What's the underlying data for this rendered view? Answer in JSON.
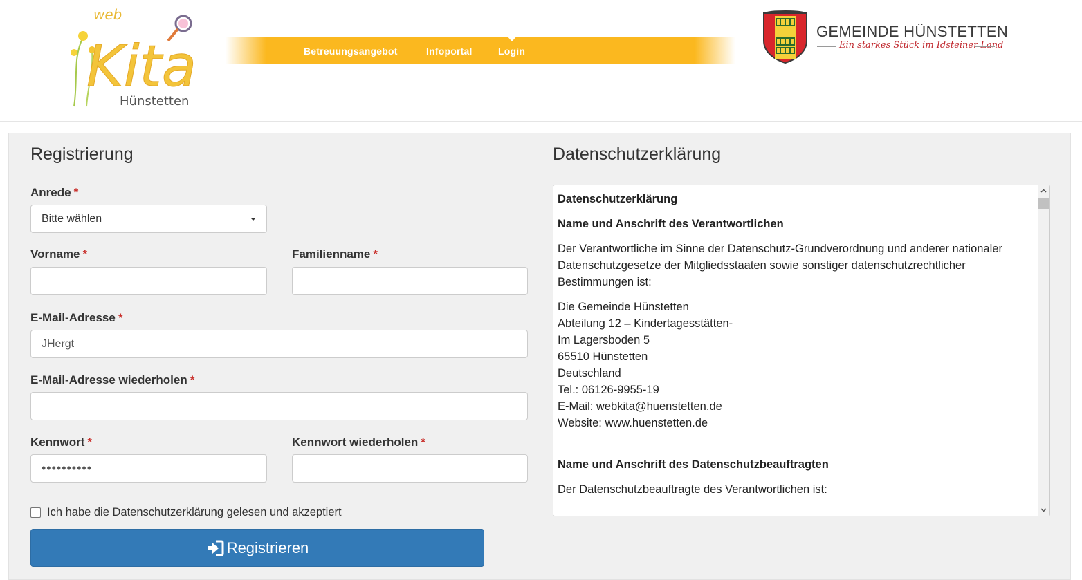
{
  "header": {
    "logo": {
      "small": "web",
      "big": "Kita",
      "sub": "Hünstetten"
    },
    "nav": [
      {
        "label": "Betreuungsangebot"
      },
      {
        "label": "Infoportal"
      },
      {
        "label": "Login"
      }
    ],
    "gemeinde": {
      "title": "GEMEINDE HÜNSTETTEN",
      "slogan": "Ein starkes Stück im Idsteiner Land"
    }
  },
  "form": {
    "title": "Registrierung",
    "required_mark": "*",
    "anrede": {
      "label": "Anrede",
      "value": "Bitte wählen"
    },
    "vorname": {
      "label": "Vorname",
      "value": ""
    },
    "familienname": {
      "label": "Familienname",
      "value": ""
    },
    "email": {
      "label": "E-Mail-Adresse",
      "value": "JHergt"
    },
    "email_repeat": {
      "label": "E-Mail-Adresse wiederholen",
      "value": ""
    },
    "password": {
      "label": "Kennwort",
      "value": "••••••••••"
    },
    "password_repeat": {
      "label": "Kennwort wiederholen",
      "value": ""
    },
    "accept_label": "Ich habe die Datenschutzerklärung gelesen und akzeptiert",
    "accept_checked": false,
    "submit_label": "Registrieren"
  },
  "privacy": {
    "title": "Datenschutzerklärung",
    "heading": "Datenschutzerklärung",
    "section1_heading": "Name und Anschrift des Verantwortlichen",
    "section1_text": "Der Verantwortliche im Sinne der Datenschutz-Grundverordnung und anderer nationaler Datenschutzgesetze der Mitgliedsstaaten sowie sonstiger datenschutzrechtlicher Bestimmungen ist:",
    "address": [
      "Die Gemeinde Hünstetten",
      "Abteilung 12 – Kindertagesstätten-",
      "Im Lagersboden 5",
      "65510 Hünstetten",
      "Deutschland",
      "Tel.: 06126-9955-19",
      "E-Mail: webkita@huenstetten.de",
      "Website: www.huenstetten.de"
    ],
    "section2_heading": "Name und Anschrift des Datenschutzbeauftragten",
    "section2_text": "Der Datenschutzbeauftragte des Verantwortlichen ist:"
  },
  "colors": {
    "nav_bar": "#fbb81f",
    "primary_button": "#337ab7",
    "required": "#c9302c",
    "slogan": "#c0272d"
  }
}
